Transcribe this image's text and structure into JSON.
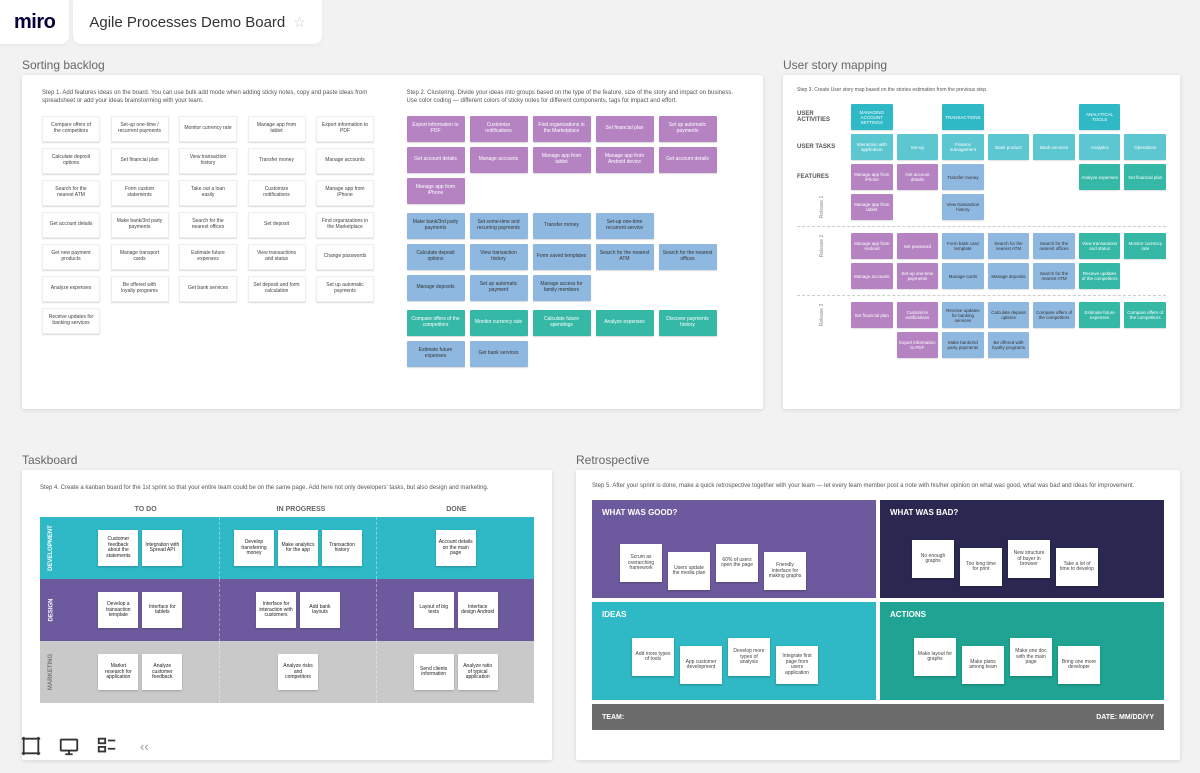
{
  "logo": "miro",
  "board_title": "Agile Processes Demo Board",
  "sections": {
    "backlog": "Sorting backlog",
    "usm": "User story mapping",
    "taskboard": "Taskboard",
    "retro": "Retrospective"
  },
  "backlog": {
    "step1": "Step 1. Add features ideas on the board. You can use bulk add mode when adding sticky notes, copy and paste ideas from spreadsheet or add your ideas brainstorming with your team.",
    "step2": "Step 2. Clustering. Divide your ideas into groups based on the type of the feature, size of the story and impact on business. Use color coding — different colors of sticky notes for different components, tags for impact and effort.",
    "white": [
      "Compare offers of the competitors",
      "Set-up one-time / recurrent payments",
      "Monitor currency rate",
      "Manage app from tablet",
      "Export information to PDF",
      "Calculate deposit options",
      "Set financial plan",
      "View transaction history",
      "Transfer money",
      "Manage accounts",
      "Search for the nearest ATM",
      "Form custom statements",
      "Take out a loan easily",
      "Customize notifications",
      "Manage app from iPhone",
      "Get account details",
      "Make bank/3rd party payments",
      "Search for the nearest offices",
      "Set deposit",
      "Find organizations in the Marketplace",
      "Get new payment products",
      "Manage transport cards",
      "Estimate future expenses",
      "View transactions and status",
      "Change passwords",
      "Analyze expenses",
      "Be offered with loyalty programs",
      "Get bank services",
      "Set deposit and form calculation",
      "Set up automatic payments",
      "Receive updates for banking services"
    ],
    "purple": [
      "Export information to PDF",
      "Customize notifications",
      "Find organizations in the Marketplace",
      "Set financial plan",
      "Set up automatic payments",
      "Get account details",
      "Manage accounts",
      "Manage app from tablet",
      "Manage app from Android device",
      "Get account details",
      "Manage app from iPhone"
    ],
    "blue": [
      "Make bank/3rd party payments",
      "Set some-time and recurring payments",
      "Transfer money",
      "Set-up one-time recurrent service",
      "Calculate deposit options",
      "View transaction history",
      "Form saved templates",
      "Search for the nearest ATM",
      "Search for the nearest offices",
      "Manage deposits",
      "Set up automatic payment",
      "Manage access for family members",
      "Estimate future expenses",
      "Get bank services"
    ],
    "teal": [
      "Compare offers of the competitors",
      "Monitor currency rate",
      "Calculate future spendings",
      "Analyze expenses",
      "Discover payments history"
    ]
  },
  "usm": {
    "step3": "Step 3. Create User story map based on the stories estimation from the previous step.",
    "rowlabels": [
      "USER ACTIVITIES",
      "USER TASKS",
      "FEATURES"
    ],
    "releases": [
      "Release 1",
      "Release 2",
      "Release 3"
    ],
    "activities": [
      "MANAGING ACCOUNT SETTINGS",
      "",
      "TRANSACTIONS",
      "",
      "",
      "ANALYTICAL TOOLS",
      ""
    ],
    "tasks": [
      "Interaction with application",
      "Set-up",
      "Finance management",
      "Bank product",
      "Bank services",
      "Analytics",
      "Operations"
    ],
    "r1": [
      [
        "Manage app from iPhone",
        "Get account details",
        "Transfer money",
        "",
        "",
        "Analyze expenses",
        "Set financial plan"
      ],
      [
        "Manage app from tablet",
        "",
        "View transaction history",
        "",
        "",
        "",
        ""
      ]
    ],
    "r2": [
      [
        "Manage app from Android",
        "Set password",
        "Form bank card template",
        "Search for the nearest ATM",
        "Search for the nearest offices",
        "View transactions and status",
        "Monitor currency rate"
      ],
      [
        "Manage accounts",
        "Set-up one-time payments",
        "Manage cards",
        "Manage deposits",
        "Search for the nearest ATM",
        "Receive updates of the competitors",
        ""
      ]
    ],
    "r3": [
      [
        "Set financial plan",
        "Customize notifications",
        "Receive updates for banking services",
        "Calculate deposit options",
        "Compare offers of the competitors",
        "Estimate future expenses",
        "Compare offers of the competitors"
      ],
      [
        "",
        "Export information to PDF",
        "Make bank/3rd party payments",
        "Be offered with loyalty programs",
        "",
        "",
        ""
      ]
    ]
  },
  "taskboard": {
    "step4": "Step 4. Create a kanban board for the 1st sprint so that your entire team could be on the same page. Add here not only developers' tasks, but also design and marketing.",
    "cols": [
      "TO DO",
      "IN PROGRESS",
      "DONE"
    ],
    "lanes": [
      "DEVELOPMENT",
      "DESIGN",
      "MARKETING"
    ],
    "dev": {
      "todo": [
        "Customer feedback about the statements",
        "Integration with Spread API"
      ],
      "prog": [
        "Develop transferring money",
        "Make analytics for the app",
        "Transaction history"
      ],
      "done": [
        "Account details on the main page"
      ]
    },
    "design": {
      "todo": [
        "Develop a transaction template",
        "Interface for tablets"
      ],
      "prog": [
        "Interface for interaction with customers",
        "Add bank layouts"
      ],
      "prog2": [],
      "done": [
        "Layout of big texts",
        "Interface design Android"
      ]
    },
    "mkt": {
      "todo": [
        "Market research for application",
        "Analyze customer feedback"
      ],
      "prog": [
        "Analyze risks and competitors"
      ],
      "done": [
        "Send clients information",
        "Analyze ratio of typical application"
      ]
    }
  },
  "retro": {
    "step5": "Step 5. After your sprint is done, make a quick retrospective together with your team — let every team member post a note with his/her opinion on what was good, what was bad and ideas for improvement.",
    "good": {
      "title": "WHAT WAS GOOD?",
      "notes": [
        "Scrum as overarching framework",
        "Users update the media plan",
        "60% of users open the page",
        "Friendly interface for making graphs"
      ]
    },
    "bad": {
      "title": "WHAT WAS BAD?",
      "notes": [
        "No enough graphs",
        "Too long time for print",
        "New structure of buyer in browser",
        "Take a lot of time to develop"
      ]
    },
    "ideas": {
      "title": "IDEAS",
      "notes": [
        "Add more types of tools",
        "App customer development",
        "Develop more types of analysis",
        "Integrate first page from users application"
      ]
    },
    "actions": {
      "title": "ACTIONS",
      "notes": [
        "Make layout for graphs",
        "Make plans among team",
        "Make one doc with the main page",
        "Bring one more developer"
      ]
    },
    "footer_team": "TEAM:",
    "footer_date": "DATE: MM/DD/YY"
  },
  "toolbar": {
    "collapse": "‹‹"
  }
}
